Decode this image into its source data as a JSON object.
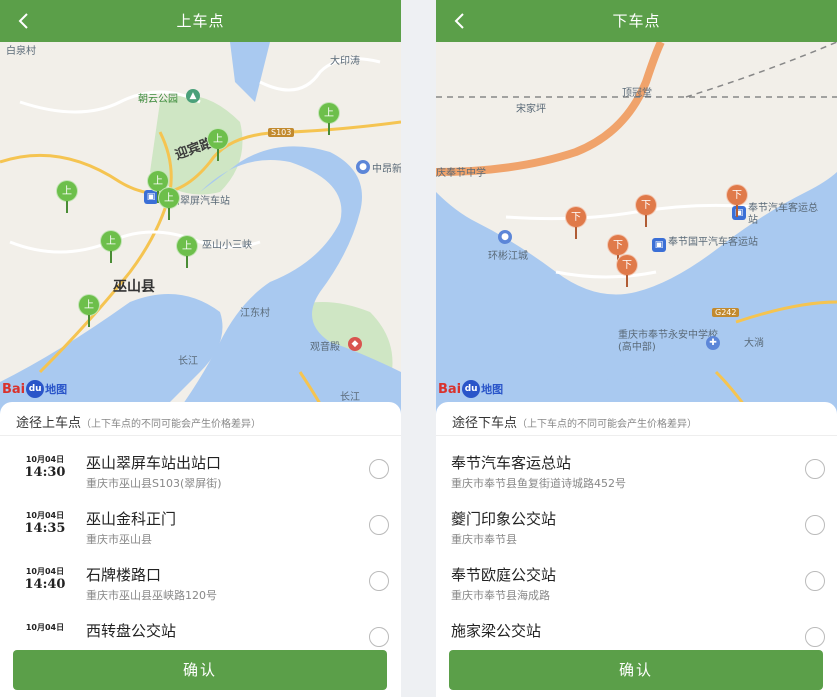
{
  "colors": {
    "accent": "#5b9f49",
    "boarding_pin": "#6dbf4b",
    "alighting_pin": "#e07a4a",
    "water": "#a9c9f0"
  },
  "boarding": {
    "title": "上车点",
    "back_icon": "chevron-left-icon",
    "pin_label": "上",
    "map_labels": {
      "baiquan": "白泉村",
      "dayin": "大印涛",
      "chaoyun": "朝云公园",
      "yingbin": "迎宾路",
      "s103": "S103",
      "zhongang": "中昂新",
      "cuiping": "巫山翠屏汽车站",
      "xiaosanxia": "巫山小三峡",
      "county": "巫山县",
      "jiangdong": "江东村",
      "guanyin": "观音殿",
      "changjiang": "长江",
      "changjiang2": "长江"
    },
    "sheet_title": "途径上车点",
    "sheet_note": "（上下车点的不同可能会产生价格差异）",
    "stops": [
      {
        "date": "10月04日",
        "time": "14:30",
        "name": "巫山翠屏车站出站口",
        "addr": "重庆市巫山县S103(翠屏街)"
      },
      {
        "date": "10月04日",
        "time": "14:35",
        "name": "巫山金科正门",
        "addr": "重庆市巫山县"
      },
      {
        "date": "10月04日",
        "time": "14:40",
        "name": "石牌楼路口",
        "addr": "重庆市巫山县巫峡路120号"
      },
      {
        "date": "10月04日",
        "time": "",
        "name": "西转盘公交站",
        "addr": ""
      }
    ],
    "confirm_label": "确认"
  },
  "alighting": {
    "title": "下车点",
    "back_icon": "chevron-left-icon",
    "pin_label": "下",
    "map_labels": {
      "songjia": "宋家坪",
      "dingguan": "顶冠堂",
      "fengjie_school": "庆奉节中学",
      "huanbin": "环彬江城",
      "guoping": "奉节国平汽车客运站",
      "keyun": "奉节汽车客运总站",
      "g242": "G242",
      "yongan": "重庆市奉节永安中学校(高中部)",
      "dawan": "大淌"
    },
    "sheet_title": "途径下车点",
    "sheet_note": "（上下车点的不同可能会产生价格差异）",
    "stops": [
      {
        "name": "奉节汽车客运总站",
        "addr": "重庆市奉节县鱼复街道诗城路452号"
      },
      {
        "name": "夔门印象公交站",
        "addr": "重庆市奉节县"
      },
      {
        "name": "奉节欧庭公交站",
        "addr": "重庆市奉节县海成路"
      },
      {
        "name": "施家梁公交站",
        "addr": ""
      }
    ],
    "confirm_label": "确认"
  },
  "baidu_logo": {
    "text": "Bai",
    "paw": "du",
    "ditu": "地图"
  }
}
